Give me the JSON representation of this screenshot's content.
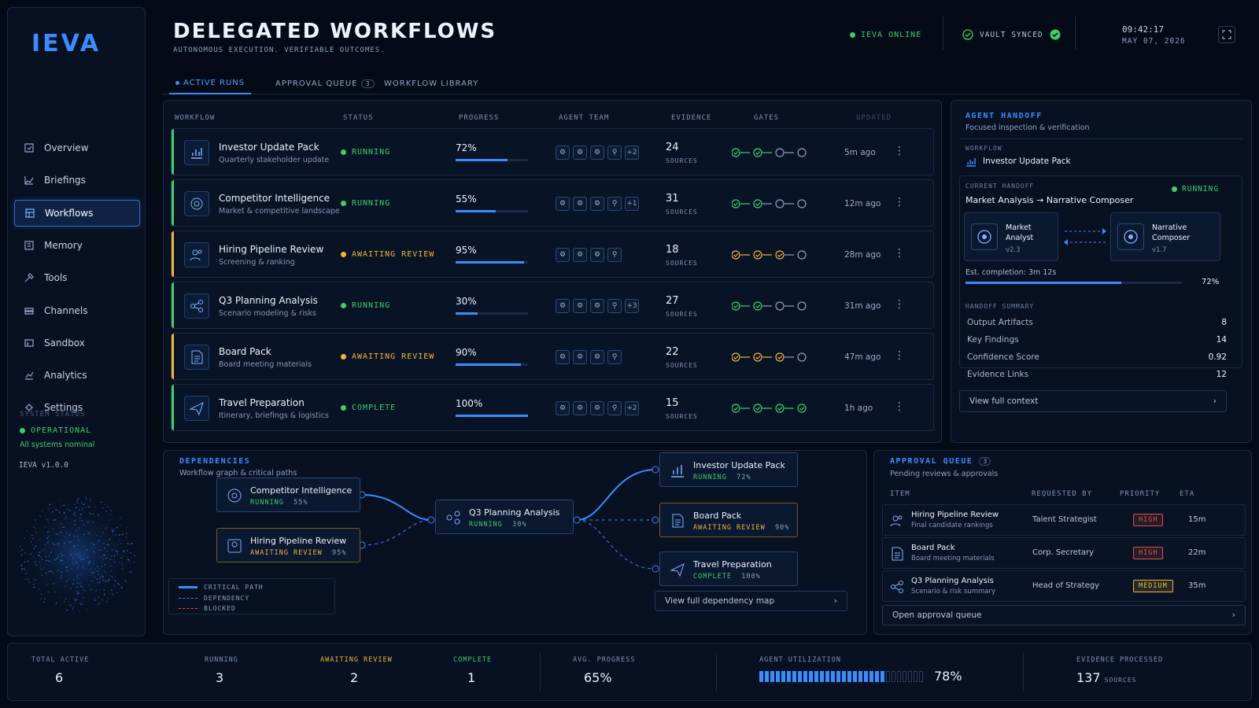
{
  "brand": "IEVA",
  "nav": [
    {
      "label": "Overview",
      "icon": "overview-icon"
    },
    {
      "label": "Briefings",
      "icon": "briefings-icon"
    },
    {
      "label": "Workflows",
      "icon": "workflows-icon",
      "active": true
    },
    {
      "label": "Memory",
      "icon": "memory-icon"
    },
    {
      "label": "Tools",
      "icon": "tools-icon"
    },
    {
      "label": "Channels",
      "icon": "channels-icon"
    },
    {
      "label": "Sandbox",
      "icon": "sandbox-icon"
    },
    {
      "label": "Analytics",
      "icon": "analytics-icon"
    },
    {
      "label": "Settings",
      "icon": "settings-icon"
    }
  ],
  "system": {
    "label": "SYSTEM STATUS",
    "status": "OPERATIONAL",
    "detail": "All systems nominal",
    "version": "IEVA v1.0.0"
  },
  "header": {
    "title": "DELEGATED WORKFLOWS",
    "subtitle": "AUTONOMOUS EXECUTION. VERIFIABLE OUTCOMES.",
    "online": "IEVA ONLINE",
    "vault": "VAULT SYNCED",
    "time": "09:42:17",
    "date": "MAY 07, 2026"
  },
  "tabs": [
    {
      "label": "ACTIVE RUNS"
    },
    {
      "label": "APPROVAL QUEUE",
      "count": "3"
    },
    {
      "label": "WORKFLOW LIBRARY"
    }
  ],
  "runs": {
    "columns": [
      "WORKFLOW",
      "STATUS",
      "PROGRESS",
      "AGENT TEAM",
      "EVIDENCE",
      "GATES",
      "UPDATED"
    ],
    "evidence_unit": "SOURCES",
    "rows": [
      {
        "name": "Investor Update Pack",
        "desc": "Quarterly stakeholder update",
        "status": "RUNNING",
        "progress": "72%",
        "progress_value": 72,
        "extra": "+2",
        "agents": 4,
        "evidence": "24",
        "gates": [
          "done",
          "done",
          "active",
          "todo"
        ],
        "updated": "5m ago",
        "icon": "chart-icon",
        "color": "#3ecf6a"
      },
      {
        "name": "Competitor Intelligence",
        "desc": "Market & competitive landscape",
        "status": "RUNNING",
        "progress": "55%",
        "progress_value": 55,
        "extra": "+1",
        "agents": 4,
        "evidence": "31",
        "gates": [
          "done",
          "done",
          "todo",
          "todo"
        ],
        "updated": "12m ago",
        "icon": "target-icon",
        "color": "#3ecf6a"
      },
      {
        "name": "Hiring Pipeline Review",
        "desc": "Screening & ranking",
        "status": "AWAITING REVIEW",
        "progress": "95%",
        "progress_value": 95,
        "extra": "",
        "agents": 4,
        "evidence": "18",
        "gates": [
          "warn",
          "warn",
          "warn",
          "todo"
        ],
        "updated": "28m ago",
        "icon": "users-icon",
        "color": "#f2b53a"
      },
      {
        "name": "Q3 Planning Analysis",
        "desc": "Scenario modeling & risks",
        "status": "RUNNING",
        "progress": "30%",
        "progress_value": 30,
        "extra": "+3",
        "agents": 4,
        "evidence": "27",
        "gates": [
          "done",
          "done",
          "todo",
          "todo"
        ],
        "updated": "31m ago",
        "icon": "network-icon",
        "color": "#3ecf6a"
      },
      {
        "name": "Board Pack",
        "desc": "Board meeting materials",
        "status": "AWAITING REVIEW",
        "progress": "90%",
        "progress_value": 90,
        "extra": "",
        "agents": 4,
        "evidence": "22",
        "gates": [
          "warn",
          "warn",
          "warn",
          "todo"
        ],
        "updated": "47m ago",
        "icon": "document-icon",
        "color": "#f2b53a"
      },
      {
        "name": "Travel Preparation",
        "desc": "Itinerary, briefings & logistics",
        "status": "COMPLETE",
        "progress": "100%",
        "progress_value": 100,
        "extra": "+2",
        "agents": 4,
        "evidence": "15",
        "gates": [
          "done",
          "done",
          "done",
          "done"
        ],
        "updated": "1h ago",
        "icon": "plane-icon",
        "color": "#3ecf6a"
      }
    ]
  },
  "handoff": {
    "title": "AGENT HANDOFF",
    "subtitle": "Focused inspection & verification",
    "workflow_label": "WORKFLOW",
    "workflow": "Investor Update Pack",
    "current_label": "CURRENT HANDOFF",
    "current": "Market Analysis → Narrative Composer",
    "status": "RUNNING",
    "from": {
      "name": "Market Analyst",
      "version": "v2.3"
    },
    "to": {
      "name": "Narrative Composer",
      "version": "v1.7"
    },
    "est": "Est. completion: 3m 12s",
    "pct": "72%",
    "pct_value": 72,
    "summary_label": "HANDOFF SUMMARY",
    "summary": [
      {
        "k": "Output Artifacts",
        "v": "8"
      },
      {
        "k": "Key Findings",
        "v": "14"
      },
      {
        "k": "Confidence Score",
        "v": "0.92"
      },
      {
        "k": "Evidence Links",
        "v": "12"
      }
    ],
    "link": "View full context"
  },
  "deps": {
    "title": "DEPENDENCIES",
    "subtitle": "Workflow graph & critical paths",
    "nodes": [
      {
        "name": "Competitor Intelligence",
        "status": "RUNNING",
        "pct": "55%"
      },
      {
        "name": "Hiring Pipeline Review",
        "status": "AWAITING REVIEW",
        "pct": "95%"
      },
      {
        "name": "Q3 Planning Analysis",
        "status": "RUNNING",
        "pct": "30%"
      },
      {
        "name": "Investor Update Pack",
        "status": "RUNNING",
        "pct": "72%"
      },
      {
        "name": "Board Pack",
        "status": "AWAITING REVIEW",
        "pct": "90%"
      },
      {
        "name": "Travel Preparation",
        "status": "COMPLETE",
        "pct": "100%"
      }
    ],
    "legend": [
      "CRITICAL PATH",
      "DEPENDENCY",
      "BLOCKED"
    ],
    "link": "View full dependency map"
  },
  "queue": {
    "title": "APPROVAL QUEUE",
    "count": "3",
    "subtitle": "Pending reviews & approvals",
    "columns": [
      "ITEM",
      "REQUESTED BY",
      "PRIORITY",
      "ETA"
    ],
    "rows": [
      {
        "name": "Hiring Pipeline Review",
        "desc": "Final candidate rankings",
        "by": "Talent Strategist",
        "priority": "HIGH",
        "eta": "15m",
        "color": "#e0523e"
      },
      {
        "name": "Board Pack",
        "desc": "Board meeting materials",
        "by": "Corp. Secretary",
        "priority": "HIGH",
        "eta": "22m",
        "color": "#e0523e"
      },
      {
        "name": "Q3 Planning Analysis",
        "desc": "Scenario & risk summary",
        "by": "Head of Strategy",
        "priority": "MEDIUM",
        "eta": "35m",
        "color": "#f2b53a"
      }
    ],
    "link": "Open approval queue"
  },
  "stats": {
    "total_label": "TOTAL ACTIVE",
    "total": "6",
    "running_label": "RUNNING",
    "running": "3",
    "awaiting_label": "AWAITING REVIEW",
    "awaiting": "2",
    "complete_label": "COMPLETE",
    "complete": "1",
    "avg_label": "AVG. PROGRESS",
    "avg": "65%",
    "util_label": "AGENT UTILIZATION",
    "util": "78%",
    "util_value": 78,
    "evidence_label": "EVIDENCE PROCESSED",
    "evidence": "137",
    "evidence_unit": "SOURCES"
  },
  "colors": {
    "accent": "#3b8cff",
    "green": "#3ecf6a",
    "amber": "#f2b53a",
    "red": "#e0523e"
  }
}
